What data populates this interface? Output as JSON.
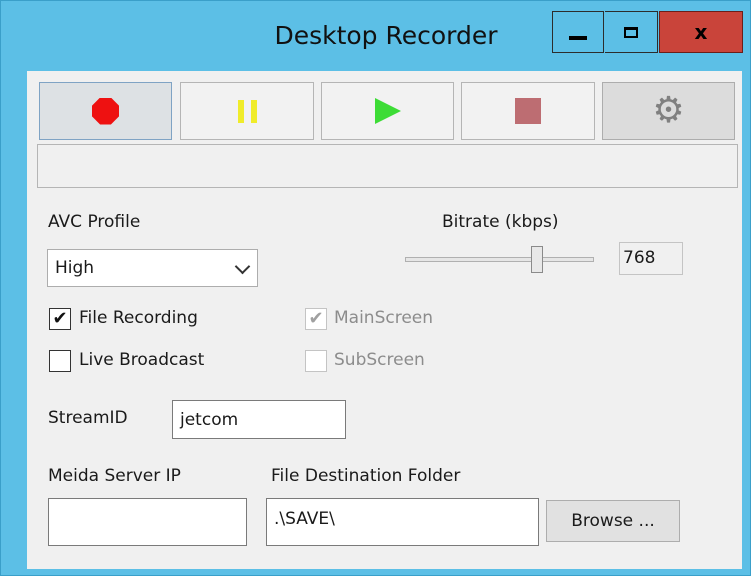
{
  "window": {
    "title": "Desktop Recorder",
    "accent": "#5cbfe6",
    "close_color": "#c9443a",
    "controls": {
      "minimize_icon": "minimize-icon",
      "maximize_icon": "maximize-icon",
      "close_label": "x"
    }
  },
  "toolbar": {
    "buttons": [
      {
        "name": "record",
        "icon": "record-icon",
        "color": "#ee1111",
        "active": true
      },
      {
        "name": "pause",
        "icon": "pause-icon",
        "color": "#f0ec2a"
      },
      {
        "name": "play",
        "icon": "play-icon",
        "color": "#3ddc36"
      },
      {
        "name": "stop",
        "icon": "stop-icon",
        "color": "#bd6d72"
      },
      {
        "name": "settings",
        "icon": "gear-icon",
        "color": "#808080"
      }
    ]
  },
  "status_text": "",
  "avc": {
    "label": "AVC Profile",
    "selected": "High"
  },
  "bitrate": {
    "label": "Bitrate (kbps)",
    "value": "768",
    "slider_fraction": 0.7
  },
  "options": {
    "file_recording": {
      "label": "File Recording",
      "checked": true
    },
    "live_broadcast": {
      "label": "Live Broadcast",
      "checked": false
    },
    "main_screen": {
      "label": "MainScreen",
      "checked": true,
      "enabled": false
    },
    "sub_screen": {
      "label": "SubScreen",
      "checked": false,
      "enabled": false
    }
  },
  "stream": {
    "label": "StreamID",
    "value": "jetcom"
  },
  "media_server": {
    "label": "Meida Server IP",
    "value": ""
  },
  "destination": {
    "label": "File Destination Folder",
    "value": ".\\SAVE\\",
    "browse_label": "Browse ..."
  }
}
